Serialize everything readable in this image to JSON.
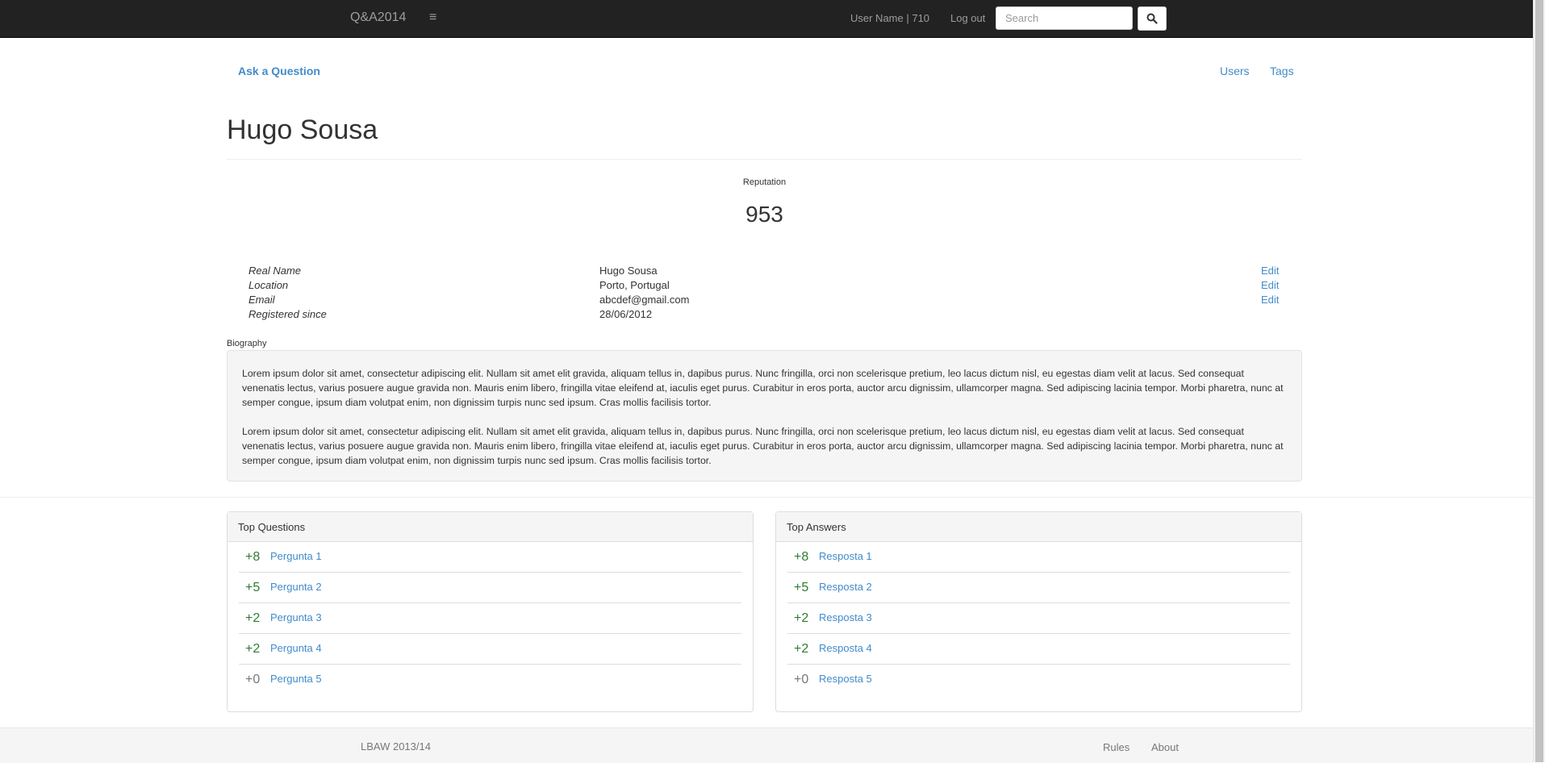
{
  "navbar": {
    "brand": "Q&A2014",
    "menu_icon": "≡",
    "user_info": "User Name | 710",
    "logout": "Log out",
    "search_placeholder": "Search"
  },
  "subnav": {
    "ask": "Ask a Question",
    "users": "Users",
    "tags": "Tags"
  },
  "profile": {
    "name": "Hugo Sousa",
    "reputation_label": "Reputation",
    "reputation": "953",
    "fields": [
      {
        "label": "Real Name",
        "value": "Hugo Sousa",
        "edit": "Edit"
      },
      {
        "label": "Location",
        "value": "Porto, Portugal",
        "edit": "Edit"
      },
      {
        "label": "Email",
        "value": "abcdef@gmail.com",
        "edit": "Edit"
      },
      {
        "label": "Registered since",
        "value": "28/06/2012",
        "edit": ""
      }
    ],
    "biography_label": "Biography",
    "biography": [
      "Lorem ipsum dolor sit amet, consectetur adipiscing elit. Nullam sit amet elit gravida, aliquam tellus in, dapibus purus. Nunc fringilla, orci non scelerisque pretium, leo lacus dictum nisl, eu egestas diam velit at lacus. Sed consequat venenatis lectus, varius posuere augue gravida non. Mauris enim libero, fringilla vitae eleifend at, iaculis eget purus. Curabitur in eros porta, auctor arcu dignissim, ullamcorper magna. Sed adipiscing lacinia tempor. Morbi pharetra, nunc at semper congue, ipsum diam volutpat enim, non dignissim turpis nunc sed ipsum. Cras mollis facilisis tortor.",
      "Lorem ipsum dolor sit amet, consectetur adipiscing elit. Nullam sit amet elit gravida, aliquam tellus in, dapibus purus. Nunc fringilla, orci non scelerisque pretium, leo lacus dictum nisl, eu egestas diam velit at lacus. Sed consequat venenatis lectus, varius posuere augue gravida non. Mauris enim libero, fringilla vitae eleifend at, iaculis eget purus. Curabitur in eros porta, auctor arcu dignissim, ullamcorper magna. Sed adipiscing lacinia tempor. Morbi pharetra, nunc at semper congue, ipsum diam volutpat enim, non dignissim turpis nunc sed ipsum. Cras mollis facilisis tortor."
    ]
  },
  "top_questions": {
    "title": "Top Questions",
    "items": [
      {
        "score": "+8",
        "label": "Pergunta 1"
      },
      {
        "score": "+5",
        "label": "Pergunta 2"
      },
      {
        "score": "+2",
        "label": "Pergunta 3"
      },
      {
        "score": "+2",
        "label": "Pergunta 4"
      },
      {
        "score": "+0",
        "label": "Pergunta 5"
      }
    ]
  },
  "top_answers": {
    "title": "Top Answers",
    "items": [
      {
        "score": "+8",
        "label": "Resposta 1"
      },
      {
        "score": "+5",
        "label": "Resposta 2"
      },
      {
        "score": "+2",
        "label": "Resposta 3"
      },
      {
        "score": "+2",
        "label": "Resposta 4"
      },
      {
        "score": "+0",
        "label": "Resposta 5"
      }
    ]
  },
  "footer": {
    "copyright": "LBAW 2013/14",
    "rules": "Rules",
    "about": "About"
  },
  "colors": {
    "navbar": "#222222",
    "link": "#428bca",
    "score_positive": "#2e7d32",
    "score_zero": "#777777"
  }
}
